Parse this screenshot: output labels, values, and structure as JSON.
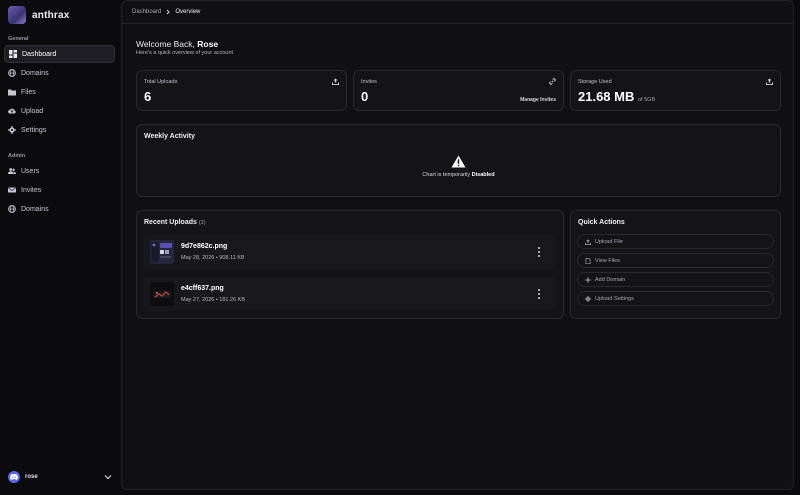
{
  "brand": {
    "name": "anthrax"
  },
  "sidebar": {
    "general_label": "General",
    "general_items": [
      {
        "label": "Dashboard",
        "icon": "dashboard-icon",
        "active": true
      },
      {
        "label": "Domains",
        "icon": "globe-icon"
      },
      {
        "label": "Files",
        "icon": "folder-icon"
      },
      {
        "label": "Upload",
        "icon": "cloud-upload-icon"
      },
      {
        "label": "Settings",
        "icon": "gear-icon"
      }
    ],
    "admin_label": "Admin",
    "admin_items": [
      {
        "label": "Users",
        "icon": "users-icon"
      },
      {
        "label": "Invites",
        "icon": "envelope-icon"
      },
      {
        "label": "Domains",
        "icon": "globe-icon"
      }
    ],
    "user": {
      "name": "rose",
      "avatar_icon": "discord-icon"
    }
  },
  "breadcrumb": {
    "parent": "Dashboard",
    "current": "Overview"
  },
  "welcome": {
    "prefix": "Welcome Back, ",
    "name": "Rose",
    "subtitle": "Here's a quick overview of your account"
  },
  "stats": {
    "uploads": {
      "title": "Total Uploads",
      "value": "6",
      "icon": "upload-icon"
    },
    "invites": {
      "title": "Invites",
      "value": "0",
      "link": "Manage Invites",
      "icon": "link-icon"
    },
    "storage": {
      "title": "Storage Used",
      "value": "21.68 MB",
      "suffix": "of 5GB",
      "icon": "upload-icon"
    }
  },
  "activity": {
    "title": "Weekly Activity",
    "message_prefix": "Chart is temporarily ",
    "message_emphasis": "Disabled",
    "icon": "warning-icon"
  },
  "recent": {
    "title": "Recent Uploads",
    "count": "(2)",
    "items": [
      {
        "name": "9d7e862c.png",
        "meta": "May 28, 2026 • 908.11 KB"
      },
      {
        "name": "e4cff637.png",
        "meta": "May 27, 2026 • 181.26 KB"
      }
    ]
  },
  "quick_actions": {
    "title": "Quick Actions",
    "items": [
      {
        "label": "Upload File",
        "icon": "upload-icon"
      },
      {
        "label": "View Files",
        "icon": "file-icon"
      },
      {
        "label": "Add Domain",
        "icon": "plus-icon"
      },
      {
        "label": "Upload Settings",
        "icon": "gear-icon"
      }
    ]
  },
  "colors": {
    "background": "#0b0a0d",
    "panel": "#141318",
    "border": "#2a2830",
    "accent": "#6a5ab8",
    "discord": "#5865f2"
  }
}
